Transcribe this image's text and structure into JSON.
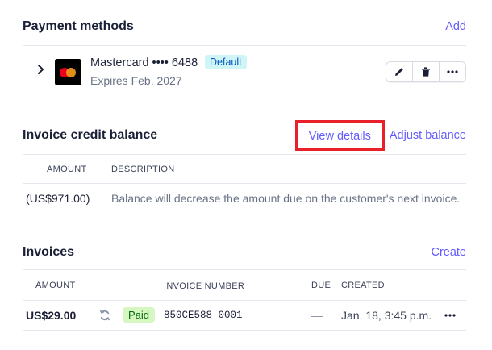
{
  "payment_methods": {
    "title": "Payment methods",
    "add_label": "Add",
    "card": {
      "brand_line": "Mastercard •••• 6488",
      "badge": "Default",
      "expires": "Expires Feb. 2027"
    }
  },
  "credit_balance": {
    "title": "Invoice credit balance",
    "view_details_label": "View details",
    "adjust_label": "Adjust balance",
    "columns": {
      "amount": "AMOUNT",
      "description": "DESCRIPTION"
    },
    "row": {
      "amount": "(US$971.00)",
      "description": "Balance will decrease the amount due on the customer's next invoice."
    }
  },
  "invoices": {
    "title": "Invoices",
    "create_label": "Create",
    "columns": {
      "amount": "AMOUNT",
      "number": "INVOICE NUMBER",
      "due": "DUE",
      "created": "CREATED"
    },
    "rows": [
      {
        "amount": "US$29.00",
        "status": "Paid",
        "number": "850CE588-0001",
        "due": "—",
        "created": "Jan. 18, 3:45 p.m."
      }
    ]
  },
  "colors": {
    "accent": "#635bff",
    "highlight_box": "#e8202a",
    "default_badge_bg": "#cff5f6",
    "paid_badge_bg": "#d7f7c2"
  },
  "icons": [
    "chevron-right-icon",
    "mastercard-logo",
    "edit-icon",
    "delete-icon",
    "more-icon",
    "retry-icon"
  ]
}
